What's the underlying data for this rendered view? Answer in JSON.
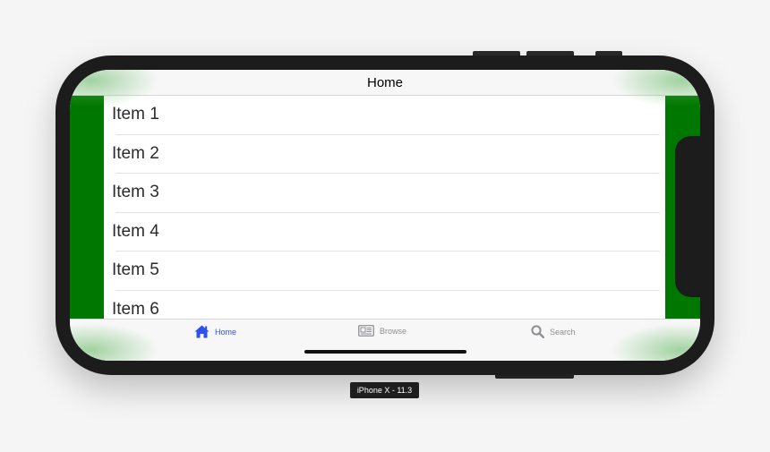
{
  "colors": {
    "accent": "#2f4ff0",
    "inactive": "#8e8e93",
    "side_bar": "#007700"
  },
  "nav": {
    "title": "Home"
  },
  "list": {
    "items": [
      {
        "label": "Item 1"
      },
      {
        "label": "Item 2"
      },
      {
        "label": "Item 3"
      },
      {
        "label": "Item 4"
      },
      {
        "label": "Item 5"
      },
      {
        "label": "Item 6"
      }
    ]
  },
  "tab_bar": {
    "tabs": [
      {
        "label": "Home",
        "icon": "home-icon",
        "selected": true
      },
      {
        "label": "Browse",
        "icon": "newspaper-icon",
        "selected": false
      },
      {
        "label": "Search",
        "icon": "search-icon",
        "selected": false
      }
    ]
  },
  "device": {
    "label": "iPhone X - 11.3"
  }
}
